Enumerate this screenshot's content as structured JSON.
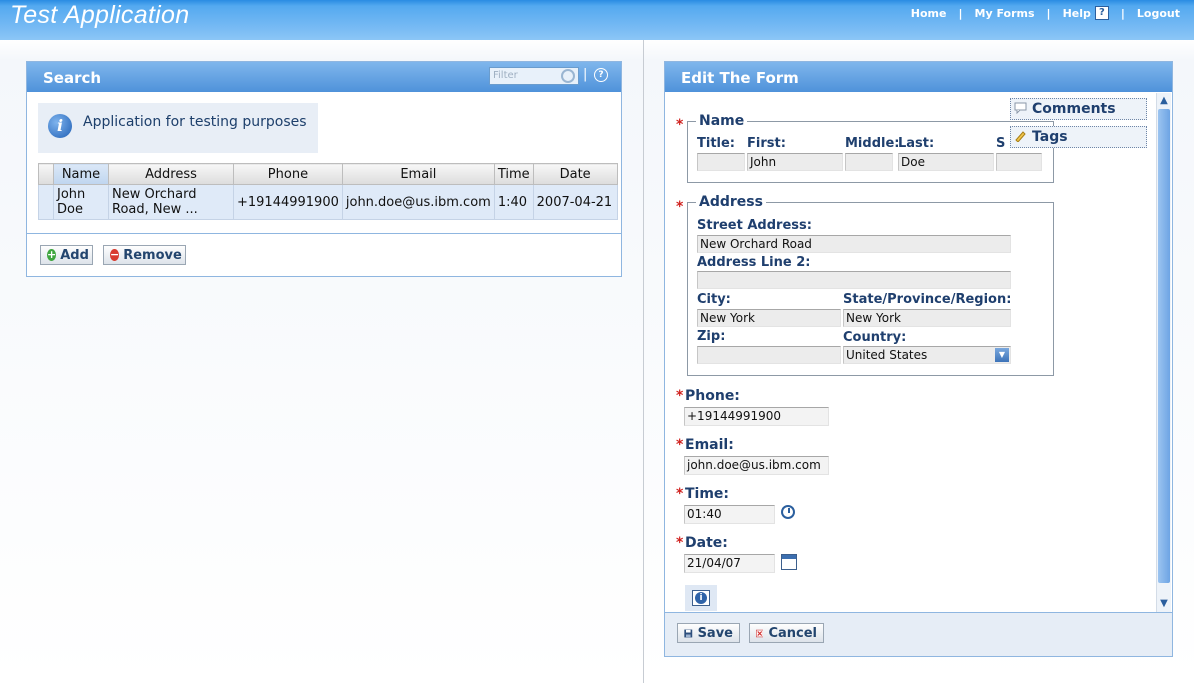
{
  "app": {
    "title": "Test Application"
  },
  "nav": {
    "home": "Home",
    "sep": "|",
    "my_forms": "My Forms",
    "help": "Help",
    "help_icon": "?",
    "logout": "Logout"
  },
  "search": {
    "title": "Search",
    "filter_placeholder": "Filter",
    "help_icon": "?",
    "info_text": "Application for testing purposes",
    "columns": [
      "Name",
      "Address",
      "Phone",
      "Email",
      "Time",
      "Date"
    ],
    "rows": [
      {
        "name": "John Doe",
        "address": "New Orchard Road, New ...",
        "phone": "+19144991900",
        "email": "john.doe@us.ibm.com",
        "time": "1:40",
        "date": "2007-04-21"
      }
    ],
    "add_label": "Add",
    "remove_label": "Remove"
  },
  "edit": {
    "title": "Edit The Form",
    "tabs": {
      "comments": "Comments",
      "tags": "Tags"
    },
    "required_mark": "*",
    "name": {
      "legend": "Name",
      "title_label": "Title:",
      "first_label": "First:",
      "middle_label": "Middle:",
      "last_label": "Last:",
      "suffix_label": "S",
      "title_value": "",
      "first_value": "John",
      "middle_value": "",
      "last_value": "Doe",
      "suffix_value": ""
    },
    "address": {
      "legend": "Address",
      "street_label": "Street Address:",
      "street_value": "New Orchard Road",
      "line2_label": "Address Line 2:",
      "line2_value": "",
      "city_label": "City:",
      "city_value": "New York",
      "state_label": "State/Province/Region:",
      "state_value": "New York",
      "zip_label": "Zip:",
      "zip_value": "",
      "country_label": "Country:",
      "country_value": "United States"
    },
    "phone": {
      "label": "Phone:",
      "value": "+19144991900"
    },
    "email": {
      "label": "Email:",
      "value": "john.doe@us.ibm.com"
    },
    "time": {
      "label": "Time:",
      "value": "01:40"
    },
    "date": {
      "label": "Date:",
      "value": "21/04/07"
    },
    "save_label": "Save",
    "cancel_label": "Cancel"
  },
  "icons": {
    "info": "info-icon",
    "add": "plus-circle-icon",
    "remove": "minus-circle-icon",
    "save": "floppy-disk-icon",
    "cancel": "x-icon",
    "clock": "clock-icon",
    "calendar": "calendar-icon"
  },
  "colors": {
    "header_blue": "#4f92da",
    "required_red": "#d0211e",
    "label_navy": "#1f3f6e"
  }
}
